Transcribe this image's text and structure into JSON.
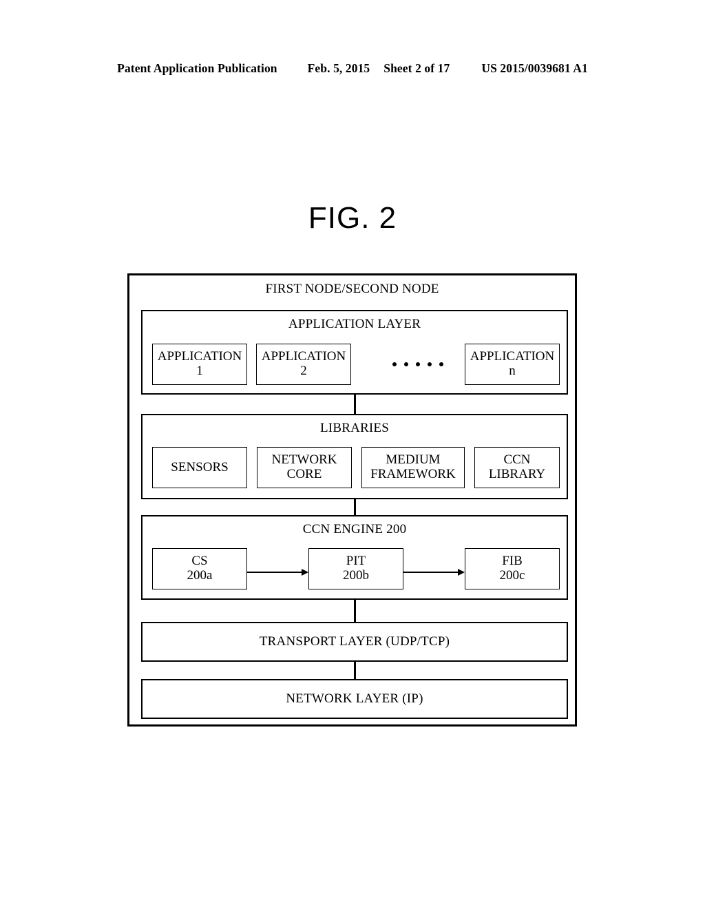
{
  "header": {
    "publication": "Patent Application Publication",
    "date": "Feb. 5, 2015",
    "sheet": "Sheet 2 of 17",
    "patent_number": "US 2015/0039681 A1"
  },
  "figure": {
    "title": "FIG. 2"
  },
  "diagram": {
    "frame_title": "FIRST NODE/SECOND NODE",
    "application_layer": {
      "title": "APPLICATION LAYER",
      "items": [
        {
          "line1": "APPLICATION",
          "line2": "1"
        },
        {
          "line1": "APPLICATION",
          "line2": "2"
        },
        {
          "line1": "APPLICATION",
          "line2": "n"
        }
      ],
      "ellipsis_dots": 5
    },
    "libraries_layer": {
      "title": "LIBRARIES",
      "items": [
        {
          "line1": "SENSORS",
          "line2": ""
        },
        {
          "line1": "NETWORK",
          "line2": "CORE"
        },
        {
          "line1": "MEDIUM",
          "line2": "FRAMEWORK"
        },
        {
          "line1": "CCN",
          "line2": "LIBRARY"
        }
      ]
    },
    "ccn_engine_layer": {
      "title": "CCN ENGINE 200",
      "items": [
        {
          "line1": "CS",
          "line2": "200a"
        },
        {
          "line1": "PIT",
          "line2": "200b"
        },
        {
          "line1": "FIB",
          "line2": "200c"
        }
      ]
    },
    "transport_layer": {
      "title": "TRANSPORT LAYER (UDP/TCP)"
    },
    "network_layer": {
      "title": "NETWORK LAYER (IP)"
    }
  }
}
